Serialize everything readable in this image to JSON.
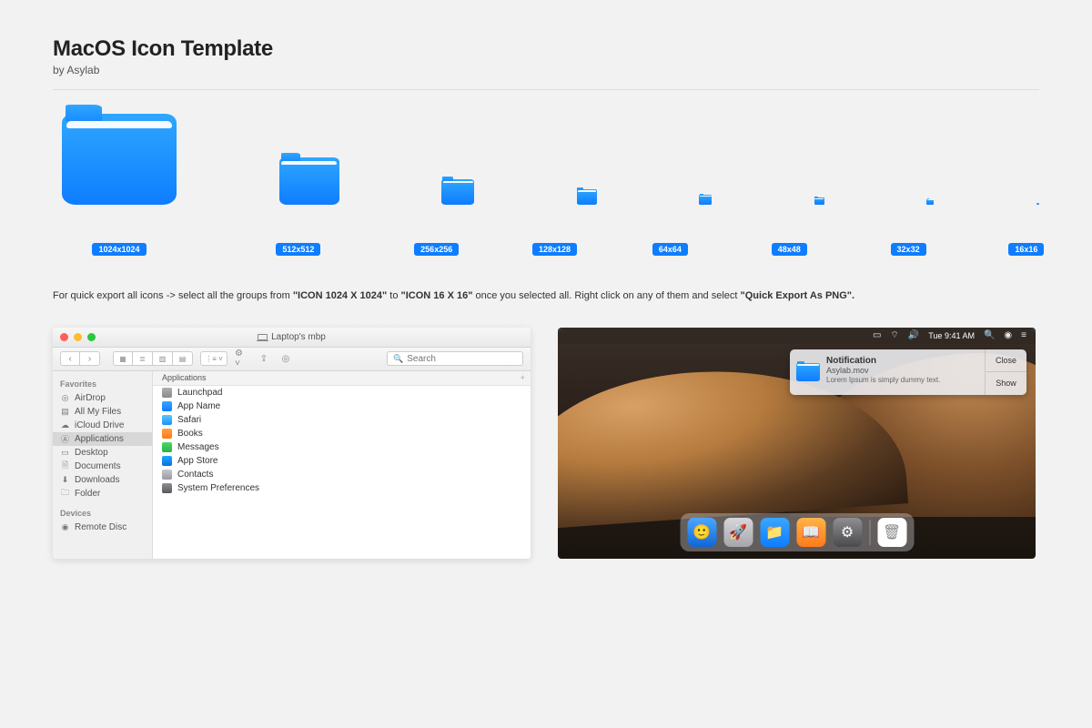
{
  "header": {
    "title": "MacOS Icon Template",
    "byline": "by Asylab"
  },
  "sizes": [
    "1024x1024",
    "512x512",
    "256x256",
    "128x128",
    "64x64",
    "48x48",
    "32x32",
    "16x16"
  ],
  "instruction": {
    "prefix": "For quick export all icons -> select all the groups from ",
    "b1": "\"ICON 1024 X 1024\"",
    "mid1": " to ",
    "b2": "\"ICON 16 X 16\"",
    "mid2": " once you selected all. Right click on any of them and select ",
    "b3": "\"Quick Export As PNG\"."
  },
  "finder": {
    "window_title": "Laptop's mbp",
    "search_placeholder": "Search",
    "column_header": "Applications",
    "sidebar": {
      "favorites_label": "Favorites",
      "devices_label": "Devices",
      "favorites": [
        "AirDrop",
        "All My Files",
        "iCloud Drive",
        "Applications",
        "Desktop",
        "Documents",
        "Downloads",
        "Folder"
      ],
      "devices": [
        "Remote Disc"
      ]
    },
    "apps": [
      "Launchpad",
      "App Name",
      "Safari",
      "Books",
      "Messages",
      "App Store",
      "Contacts",
      "System Preferences"
    ]
  },
  "desktop": {
    "menubar_time": "Tue 9:41 AM",
    "notification": {
      "title": "Notification",
      "subtitle": "Asylab.mov",
      "body": "Lorem Ipsum is simply dummy text.",
      "close": "Close",
      "show": "Show"
    }
  }
}
